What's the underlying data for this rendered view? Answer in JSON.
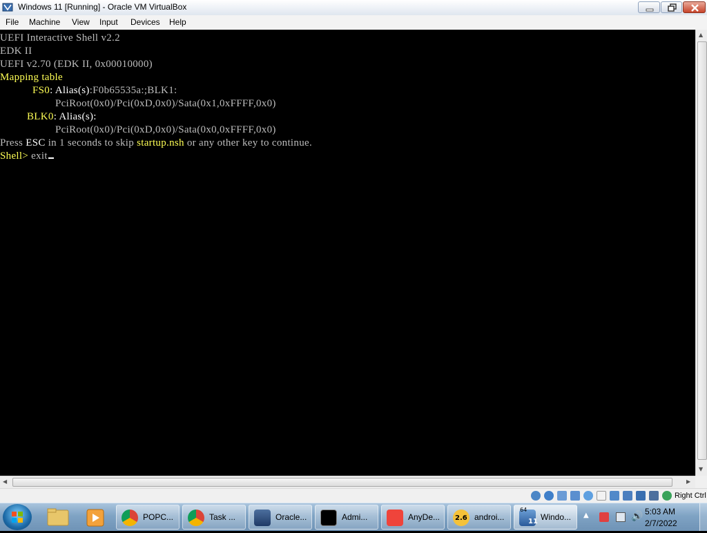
{
  "window": {
    "title": "Windows 11 [Running] - Oracle VM VirtualBox"
  },
  "menu": [
    "File",
    "Machine",
    "View",
    "Input",
    "Devices",
    "Help"
  ],
  "console": {
    "line1": "UEFI Interactive Shell v2.2",
    "line2": "EDK II",
    "line3": "UEFI v2.70 (EDK II, 0x00010000)",
    "line4": "Mapping table",
    "fs0_name": "FS0",
    "fs0_alias_label": ": Alias(s)",
    "fs0_alias_value": ":F0b65535a:;BLK1:",
    "fs0_path": "PciRoot(0x0)/Pci(0xD,0x0)/Sata(0x1,0xFFFF,0x0)",
    "blk0_name": "BLK0",
    "blk0_alias_label": ": Alias(s):",
    "blk0_path": "PciRoot(0x0)/Pci(0xD,0x0)/Sata(0x0,0xFFFF,0x0)",
    "press_a": "Press ",
    "press_esc": "ESC",
    "press_b": " in 1 seconds to skip ",
    "press_startup": "startup.nsh",
    "press_c": " or any other key to continue.",
    "prompt": "Shell> ",
    "command": "exit"
  },
  "statusbar": {
    "host_key": "Right Ctrl"
  },
  "taskbar": {
    "tasks": [
      {
        "label": "POPC...",
        "icon": "chrome-icon"
      },
      {
        "label": "Task ...",
        "icon": "chrome-icon"
      },
      {
        "label": "Oracle...",
        "icon": "virtualbox-icon"
      },
      {
        "label": "Admi...",
        "icon": "cmd-icon"
      },
      {
        "label": "AnyDe...",
        "icon": "anydesk-icon"
      },
      {
        "label": "androi...",
        "icon": "android-icon"
      },
      {
        "label": "Windo...",
        "icon": "virtualbox-vm-icon"
      }
    ],
    "android_badge": "2.6",
    "vm_badge": "11",
    "vm_badge_top": "64",
    "clock_time": "5:03 AM",
    "clock_date": "2/7/2022"
  },
  "colors": {
    "console_text": "#bdbdbd",
    "console_highlight": "#ffff55",
    "console_white": "#ffffff"
  }
}
